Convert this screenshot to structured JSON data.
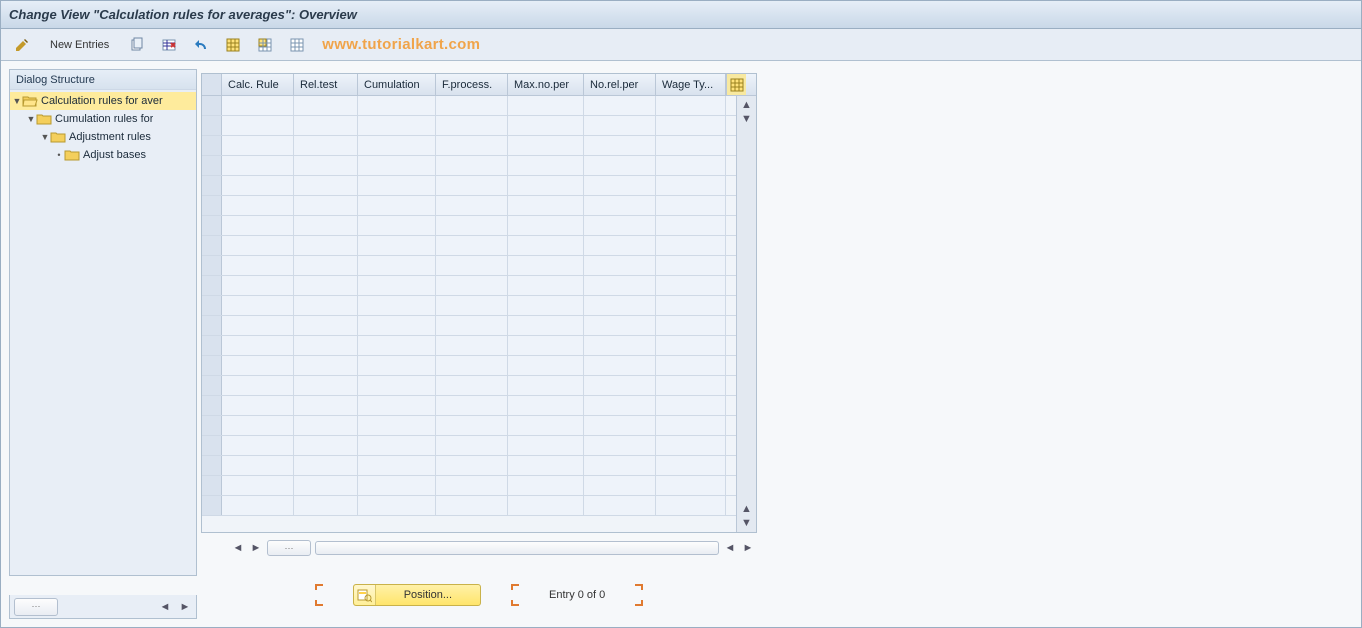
{
  "title": "Change View \"Calculation rules for averages\": Overview",
  "toolbar": {
    "new_entries": "New Entries"
  },
  "watermark": "www.tutorialkart.com",
  "sidebar": {
    "header": "Dialog Structure",
    "nodes": [
      {
        "label": "Calculation rules for aver",
        "level": 0,
        "selected": true,
        "open": true
      },
      {
        "label": "Cumulation rules for",
        "level": 1,
        "selected": false,
        "open": false
      },
      {
        "label": "Adjustment rules",
        "level": 2,
        "selected": false,
        "open": false
      },
      {
        "label": "Adjust bases",
        "level": 3,
        "selected": false,
        "open": false,
        "leaf": true
      }
    ]
  },
  "grid": {
    "columns": [
      {
        "label": "Calc. Rule",
        "width": 72
      },
      {
        "label": "Rel.test",
        "width": 64
      },
      {
        "label": "Cumulation",
        "width": 78
      },
      {
        "label": "F.process.",
        "width": 72
      },
      {
        "label": "Max.no.per",
        "width": 76
      },
      {
        "label": "No.rel.per",
        "width": 72
      },
      {
        "label": "Wage Ty...",
        "width": 70
      }
    ],
    "empty_rows": 21
  },
  "footer": {
    "position_button": "Position...",
    "entry_text": "Entry 0 of 0"
  }
}
